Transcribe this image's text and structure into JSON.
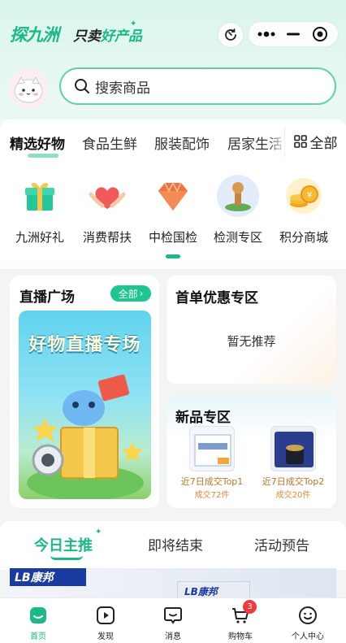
{
  "header": {
    "logo": "探九洲",
    "slogan_prefix": "只卖",
    "slogan_highlight": "好产品"
  },
  "search": {
    "placeholder": "搜索商品"
  },
  "categories": {
    "items": [
      "精选好物",
      "食品生鲜",
      "服装配饰",
      "居家生活"
    ],
    "all_label": "全部"
  },
  "shortcuts": [
    {
      "label": "九洲好礼",
      "icon": "gift-icon"
    },
    {
      "label": "消费帮扶",
      "icon": "heart-hands-icon"
    },
    {
      "label": "中检国检",
      "icon": "diamond-icon"
    },
    {
      "label": "检测专区",
      "icon": "stamp-icon"
    },
    {
      "label": "积分商城",
      "icon": "coins-icon"
    }
  ],
  "live": {
    "title": "直播广场",
    "all_label": "全部",
    "banner_text": "好物直播专场"
  },
  "first_order": {
    "title": "首单优惠专区",
    "empty_text": "暂无推荐"
  },
  "new_products": {
    "title": "新品专区",
    "items": [
      {
        "rank": "近7日成交Top1",
        "sold": "成交72件"
      },
      {
        "rank": "近7日成交Top2",
        "sold": "成交20件"
      }
    ]
  },
  "today": {
    "tabs": [
      "今日主推",
      "即将结束",
      "活动预告"
    ],
    "brand": "LB康邦"
  },
  "tabbar": {
    "items": [
      {
        "label": "首页",
        "icon": "home-icon"
      },
      {
        "label": "发现",
        "icon": "play-icon"
      },
      {
        "label": "消息",
        "icon": "message-icon"
      },
      {
        "label": "购物车",
        "icon": "cart-icon"
      },
      {
        "label": "个人中心",
        "icon": "smile-icon"
      }
    ],
    "cart_badge": "3"
  },
  "colors": {
    "accent": "#1cb886",
    "badge": "#ef3b3b"
  }
}
